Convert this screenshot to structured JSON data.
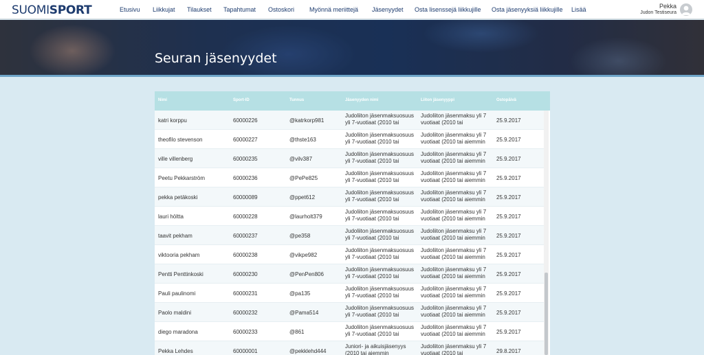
{
  "brand": {
    "logo_left": "SUOMI",
    "logo_right": "SPORT"
  },
  "nav": [
    "Etusivu",
    "Liikkujat",
    "Tilaukset",
    "Tapahtumat",
    "Ostoskori",
    "Myönnä meriittejä",
    "Jäsenyydet",
    "Osta lisenssejä liikkujille",
    "Osta jäsenyyksiä liikkujille",
    "Lisää"
  ],
  "user": {
    "name": "Pekka",
    "club": "Judon Testiseura"
  },
  "hero": {
    "title": "Seuran jäsenyydet"
  },
  "table": {
    "headers": [
      "Nimi",
      "Sport-ID",
      "Tunnus",
      "Jäsenyyden nimi",
      "Liiton jäsenyyppi",
      "Ostopäivä"
    ],
    "rows": [
      [
        "katri korppu",
        "60000226",
        "@katrkorp981",
        "Judoliiton jäsenmaksuosuus yli 7-vuotiaat (2010 tai",
        "Judoliiton jäsenmaksu yli 7 vuotiaat (2010 tai",
        "25.9.2017"
      ],
      [
        "theofilo stevenson",
        "60000227",
        "@thste163",
        "Judoliiton jäsenmaksuosuus yli 7-vuotiaat (2010 tai",
        "Judoliiton jäsenmaksu yli 7 vuotiaat (2010 tai aiemmin",
        "25.9.2017"
      ],
      [
        "ville villenberg",
        "60000235",
        "@vilv387",
        "Judoliiton jäsenmaksuosuus yli 7-vuotiaat (2010 tai",
        "Judoliiton jäsenmaksu yli 7 vuotiaat (2010 tai aiemmin",
        "25.9.2017"
      ],
      [
        "Peetu Pekkarström",
        "60000236",
        "@PePe825",
        "Judoliiton jäsenmaksuosuus yli 7-vuotiaat (2010 tai",
        "Judoliiton jäsenmaksu yli 7 vuotiaat (2010 tai aiemmin",
        "25.9.2017"
      ],
      [
        "pekka petäkoski",
        "60000089",
        "@ppet612",
        "Judoliiton jäsenmaksuosuus yli 7-vuotiaat (2010 tai",
        "Judoliiton jäsenmaksu yli 7 vuotiaat (2010 tai aiemmin",
        "25.9.2017"
      ],
      [
        "lauri höltta",
        "60000228",
        "@laurholt379",
        "Judoliiton jäsenmaksuosuus yli 7-vuotiaat (2010 tai",
        "Judoliiton jäsenmaksu yli 7 vuotiaat (2010 tai aiemmin",
        "25.9.2017"
      ],
      [
        "taavit pekham",
        "60000237",
        "@pe358",
        "Judoliiton jäsenmaksuosuus yli 7-vuotiaat (2010 tai",
        "Judoliiton jäsenmaksu yli 7 vuotiaat (2010 tai aiemmin",
        "25.9.2017"
      ],
      [
        "viktooria pekham",
        "60000238",
        "@vikpe982",
        "Judoliiton jäsenmaksuosuus yli 7-vuotiaat (2010 tai",
        "Judoliiton jäsenmaksu yli 7 vuotiaat (2010 tai aiemmin",
        "25.9.2017"
      ],
      [
        "Pentti Penttinkoski",
        "60000230",
        "@PenPen806",
        "Judoliiton jäsenmaksuosuus yli 7-vuotiaat (2010 tai",
        "Judoliiton jäsenmaksu yli 7 vuotiaat (2010 tai aiemmin",
        "25.9.2017"
      ],
      [
        "Pauli paulinomi",
        "60000231",
        "@pa135",
        "Judoliiton jäsenmaksuosuus yli 7-vuotiaat (2010 tai",
        "Judoliiton jäsenmaksu yli 7 vuotiaat (2010 tai aiemmin",
        "25.9.2017"
      ],
      [
        "Paolo maldini",
        "60000232",
        "@Pama514",
        "Judoliiton jäsenmaksuosuus yli 7-vuotiaat (2010 tai",
        "Judoliiton jäsenmaksu yli 7 vuotiaat (2010 tai aiemmin",
        "25.9.2017"
      ],
      [
        "diego maradona",
        "60000233",
        "@861",
        "Judoliiton jäsenmaksuosuus yli 7-vuotiaat (2010 tai",
        "Judoliiton jäsenmaksu yli 7 vuotiaat (2010 tai aiemmin",
        "25.9.2017"
      ],
      [
        "Pekka Lehdes",
        "60000001",
        "@pekklehd444",
        "Juniori- ja aikuisjäsenyys (2010 tai aiemmin",
        "Judoliiton jäsenmaksu yli 7 vuotiaat (2010 tai",
        "29.8.2017"
      ]
    ]
  }
}
